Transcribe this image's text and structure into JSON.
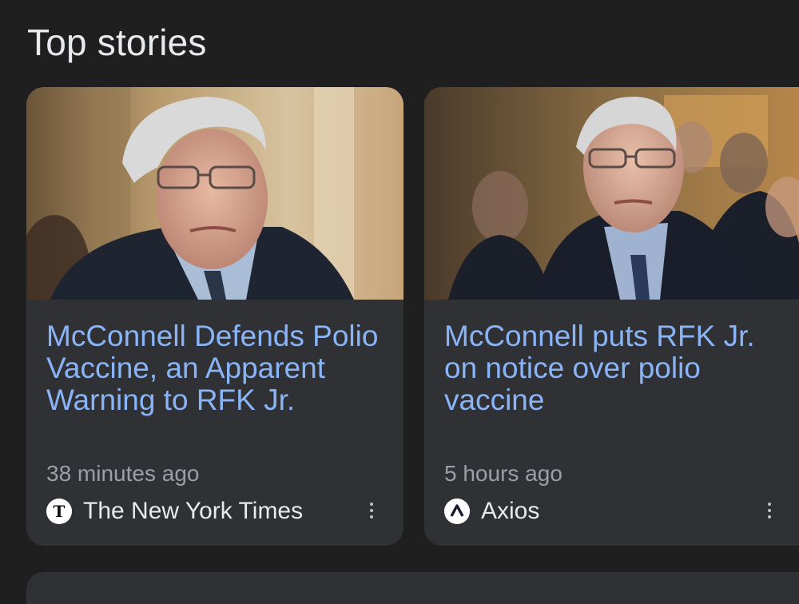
{
  "section": {
    "title": "Top stories"
  },
  "stories": [
    {
      "headline": "McConnell Defends Polio Vaccine, an Apparent Warning to RFK Jr.",
      "time": "38 minutes ago",
      "source": "The New York Times",
      "source_icon": "nyt-logo-icon",
      "image": "photo-mitch-mcconnell-portrait"
    },
    {
      "headline": "McConnell puts RFK Jr. on notice over polio vaccine",
      "time": "5 hours ago",
      "source": "Axios",
      "source_icon": "axios-logo-icon",
      "image": "photo-mitch-mcconnell-crowd"
    }
  ],
  "colors": {
    "background": "#1f1f1f",
    "card": "#303134",
    "headline": "#8ab4f8",
    "meta_text": "#9aa0a6",
    "primary_text": "#e8eaed"
  }
}
